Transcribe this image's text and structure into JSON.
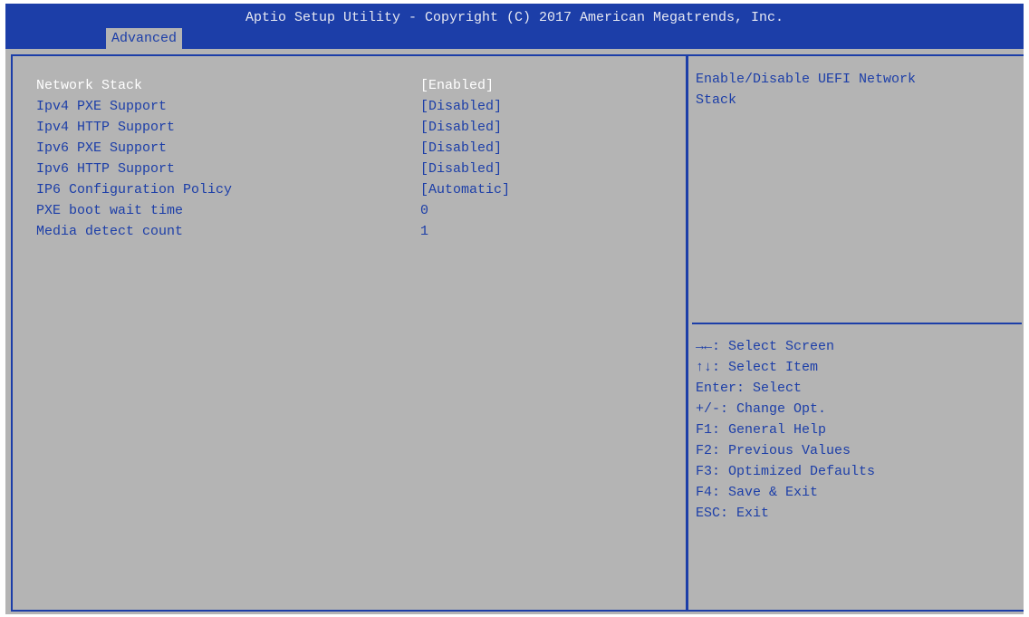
{
  "header": {
    "title": "Aptio Setup Utility - Copyright (C) 2017 American Megatrends, Inc.",
    "active_tab": "Advanced"
  },
  "settings": [
    {
      "label": "Network Stack",
      "value": "[Enabled]"
    },
    {
      "label": "Ipv4 PXE Support",
      "value": "[Disabled]"
    },
    {
      "label": "Ipv4 HTTP Support",
      "value": "[Disabled]"
    },
    {
      "label": "Ipv6 PXE Support",
      "value": "[Disabled]"
    },
    {
      "label": "Ipv6 HTTP Support",
      "value": "[Disabled]"
    },
    {
      "label": "IP6 Configuration Policy",
      "value": "[Automatic]"
    },
    {
      "label": "PXE boot wait time",
      "value": "0"
    },
    {
      "label": "Media detect count",
      "value": "1"
    }
  ],
  "help": {
    "line1": "Enable/Disable UEFI Network",
    "line2": "Stack"
  },
  "keys": [
    "→←: Select Screen",
    "↑↓: Select Item",
    "Enter: Select",
    "+/-: Change Opt.",
    "F1: General Help",
    "F2: Previous Values",
    "F3: Optimized Defaults",
    "F4: Save & Exit",
    "ESC: Exit"
  ],
  "colors": {
    "header_blue": "#1c3ea8",
    "panel_gray": "#b4b4b4",
    "selected_text": "#ffffff"
  }
}
